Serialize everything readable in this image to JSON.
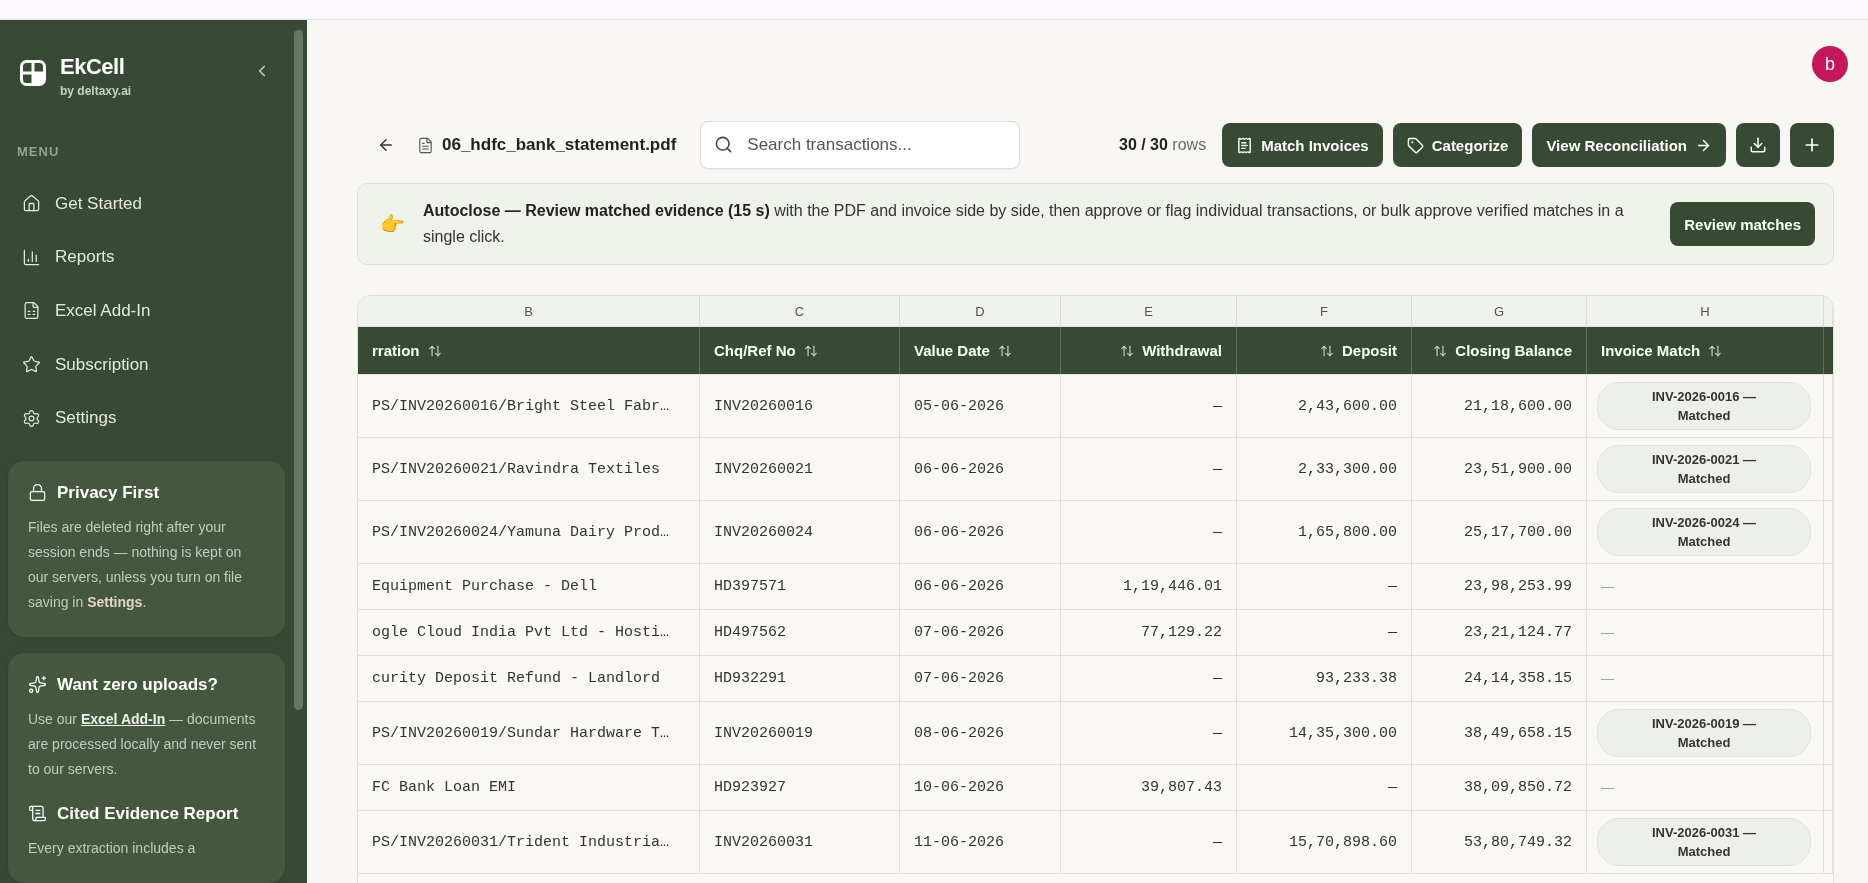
{
  "sidebar": {
    "brand": "EkCell",
    "tagline": "by deltaxy.ai",
    "menu_label": "MENU",
    "items": [
      {
        "kind": "home",
        "label": "Get Started"
      },
      {
        "kind": "chart",
        "label": "Reports"
      },
      {
        "kind": "sheet",
        "label": "Excel Add-In"
      },
      {
        "kind": "star",
        "label": "Subscription"
      },
      {
        "kind": "gear",
        "label": "Settings"
      }
    ],
    "privacy_card": {
      "title": "Privacy First",
      "text": "Files are deleted right after your session ends — nothing is kept on our servers, unless you turn on file saving in **Settings**."
    },
    "uploads_card": {
      "title": "Want zero uploads?",
      "text_before": "Use our",
      "link": "Excel Add-In",
      "text_after": "— documents are processed locally and never sent to our servers.",
      "section_title": "Cited Evidence Report",
      "section_text": "Every extraction includes a"
    }
  },
  "avatar": {
    "initial": "b"
  },
  "toolbar": {
    "file_name": "06_hdfc_bank_statement.pdf",
    "search": {
      "placeholder": "Search transactions..."
    },
    "row_count": "**30 / 30** rows",
    "buttons": [
      {
        "kind": "receipt",
        "label": "Match Invoices"
      },
      {
        "kind": "tag",
        "label": "Categorize"
      },
      {
        "kind": "arrow",
        "label": "View Reconciliation"
      }
    ]
  },
  "banner": {
    "emoji": "👉",
    "text": "**Autoclose — Review matched evidence (15 s)** with the PDF and invoice side by side, then approve or flag individual transactions, or bulk approve verified matches in a single click.",
    "button": "Review matches"
  },
  "table": {
    "columns": [
      {
        "letter": "B",
        "label": "rration",
        "kind": "text"
      },
      {
        "letter": "C",
        "label": "Chq/Ref No",
        "kind": "text"
      },
      {
        "letter": "D",
        "label": "Value Date",
        "kind": "text"
      },
      {
        "letter": "E",
        "label": "Withdrawal",
        "kind": "number"
      },
      {
        "letter": "F",
        "label": "Deposit",
        "kind": "number"
      },
      {
        "letter": "G",
        "label": "Closing Balance",
        "kind": "number"
      },
      {
        "letter": "H",
        "label": "Invoice Match",
        "kind": "text"
      }
    ],
    "rows": [
      {
        "narration": "PS/INV20260016/Bright Steel Fabr…",
        "ref": "INV20260016",
        "date": "05-06-2026",
        "withdrawal": "—",
        "deposit": "2,43,600.00",
        "balance": "21,18,600.00",
        "match": {
          "kind": "pill",
          "text": "INV-2026-0016 — Matched"
        }
      },
      {
        "narration": "PS/INV20260021/Ravindra Textiles",
        "ref": "INV20260021",
        "date": "06-06-2026",
        "withdrawal": "—",
        "deposit": "2,33,300.00",
        "balance": "23,51,900.00",
        "match": {
          "kind": "pill",
          "text": "INV-2026-0021 — Matched"
        }
      },
      {
        "narration": "PS/INV20260024/Yamuna Dairy Prod…",
        "ref": "INV20260024",
        "date": "06-06-2026",
        "withdrawal": "—",
        "deposit": "1,65,800.00",
        "balance": "25,17,700.00",
        "match": {
          "kind": "pill",
          "text": "INV-2026-0024 — Matched"
        }
      },
      {
        "narration": "Equipment Purchase - Dell",
        "ref": "HD397571",
        "date": "06-06-2026",
        "withdrawal": "1,19,446.01",
        "deposit": "—",
        "balance": "23,98,253.99",
        "match": {
          "kind": "dash",
          "text": "—"
        }
      },
      {
        "narration": "ogle Cloud India Pvt Ltd - Hosti…",
        "ref": "HD497562",
        "date": "07-06-2026",
        "withdrawal": "77,129.22",
        "deposit": "—",
        "balance": "23,21,124.77",
        "match": {
          "kind": "dash",
          "text": "—"
        }
      },
      {
        "narration": "curity Deposit Refund - Landlord",
        "ref": "HD932291",
        "date": "07-06-2026",
        "withdrawal": "—",
        "deposit": "93,233.38",
        "balance": "24,14,358.15",
        "match": {
          "kind": "dash",
          "text": "—"
        }
      },
      {
        "narration": "PS/INV20260019/Sundar Hardware T…",
        "ref": "INV20260019",
        "date": "08-06-2026",
        "withdrawal": "—",
        "deposit": "14,35,300.00",
        "balance": "38,49,658.15",
        "match": {
          "kind": "pill",
          "text": "INV-2026-0019 — Matched"
        }
      },
      {
        "narration": "FC Bank Loan EMI",
        "ref": "HD923927",
        "date": "10-06-2026",
        "withdrawal": "39,807.43",
        "deposit": "—",
        "balance": "38,09,850.72",
        "match": {
          "kind": "dash",
          "text": "—"
        }
      },
      {
        "narration": "PS/INV20260031/Trident Industria…",
        "ref": "INV20260031",
        "date": "11-06-2026",
        "withdrawal": "—",
        "deposit": "15,70,898.60",
        "balance": "53,80,749.32",
        "match": {
          "kind": "pill",
          "text": "INV-2026-0031 — Matched"
        }
      }
    ]
  }
}
